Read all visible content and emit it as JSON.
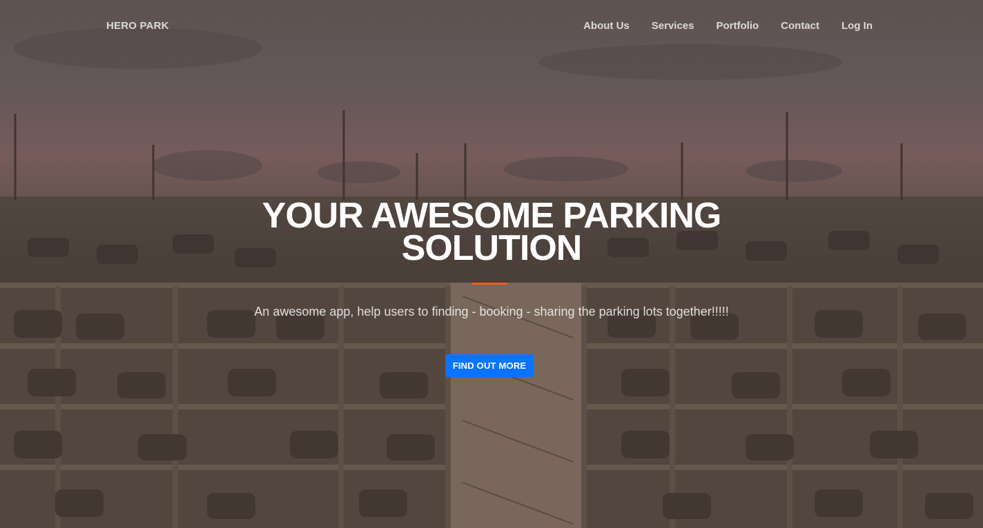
{
  "brand": "HERO PARK",
  "nav": {
    "links": [
      "About Us",
      "Services",
      "Portfolio",
      "Contact",
      "Log In"
    ]
  },
  "hero": {
    "headline_line1": "YOUR AWESOME PARKING",
    "headline_line2": "SOLUTION",
    "tagline": "An awesome app, help users to finding - booking - sharing the parking lots together!!!!!",
    "cta_label": "FIND OUT MORE"
  },
  "colors": {
    "accent_divider": "#f05f1c",
    "cta_button": "#0b73ff",
    "overlay": "#5c483c"
  }
}
